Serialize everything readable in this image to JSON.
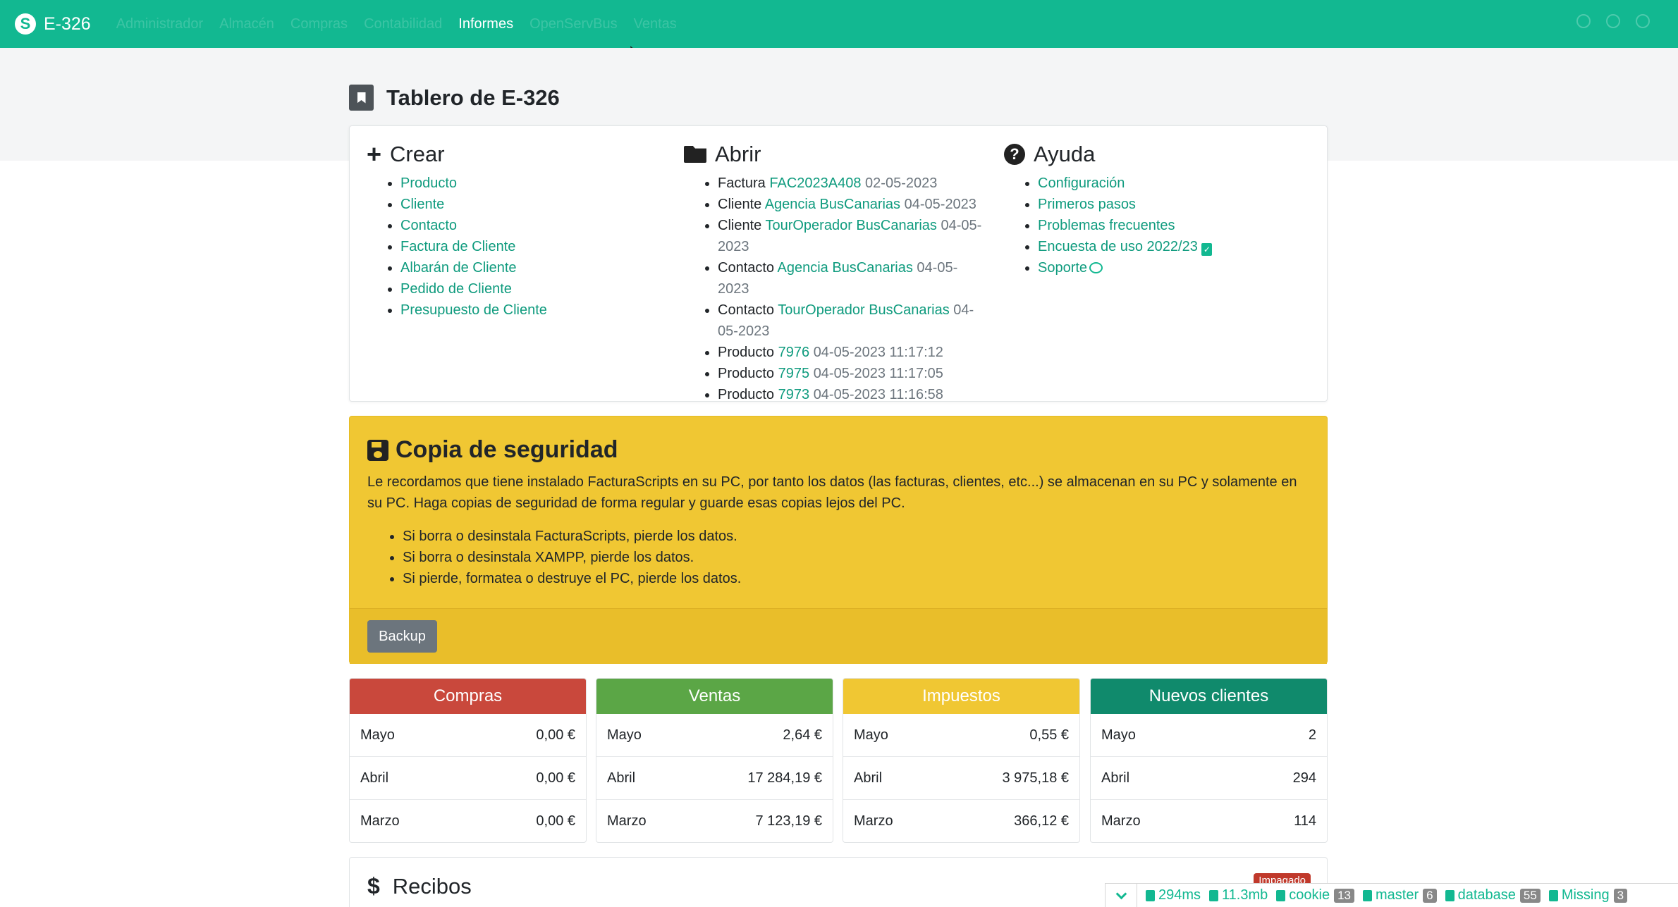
{
  "navbar": {
    "brand_logo": "S",
    "brand_name": "E-326",
    "menu": [
      "Administrador",
      "Almacén",
      "Compras",
      "Contabilidad",
      "Informes",
      "OpenServBus",
      "Ventas"
    ],
    "active": "Informes"
  },
  "page": {
    "title": "Tablero de E-326"
  },
  "crear": {
    "title": "Crear",
    "items": [
      "Producto",
      "Cliente",
      "Contacto",
      "Factura de Cliente",
      "Albarán de Cliente",
      "Pedido de Cliente",
      "Presupuesto de Cliente"
    ]
  },
  "abrir": {
    "title": "Abrir",
    "items": [
      {
        "type": "Factura",
        "link": "FAC2023A408",
        "date": "02-05-2023"
      },
      {
        "type": "Cliente",
        "link": "Agencia BusCanarias",
        "date": "04-05-2023"
      },
      {
        "type": "Cliente",
        "link": "TourOperador BusCanarias",
        "date": "04-05-2023"
      },
      {
        "type": "Contacto",
        "link": "Agencia BusCanarias",
        "date": "04-05-2023"
      },
      {
        "type": "Contacto",
        "link": "TourOperador BusCanarias",
        "date": "04-05-2023"
      },
      {
        "type": "Producto",
        "link": "7976",
        "date": "04-05-2023 11:17:12"
      },
      {
        "type": "Producto",
        "link": "7975",
        "date": "04-05-2023 11:17:05"
      },
      {
        "type": "Producto",
        "link": "7973",
        "date": "04-05-2023 11:16:58"
      }
    ]
  },
  "ayuda": {
    "title": "Ayuda",
    "items": [
      "Configuración",
      "Primeros pasos",
      "Problemas frecuentes",
      "Encuesta de uso 2022/23",
      "Soporte"
    ]
  },
  "backup": {
    "title": "Copia de seguridad",
    "text": "Le recordamos que tiene instalado FacturaScripts en su PC, por tanto los datos (las facturas, clientes, etc...) se almacenan en su PC y solamente en su PC. Haga copias de seguridad de forma regular y guarde esas copias lejos del PC.",
    "bullets": [
      "Si borra o desinstala FacturaScripts, pierde los datos.",
      "Si borra o desinstala XAMPP, pierde los datos.",
      "Si pierde, formatea o destruye el PC, pierde los datos."
    ],
    "button": "Backup"
  },
  "stats": [
    {
      "title": "Compras",
      "color": "#c9483c",
      "rows": [
        [
          "Mayo",
          "0,00 €"
        ],
        [
          "Abril",
          "0,00 €"
        ],
        [
          "Marzo",
          "0,00 €"
        ]
      ]
    },
    {
      "title": "Ventas",
      "color": "#5ba646",
      "rows": [
        [
          "Mayo",
          "2,64 €"
        ],
        [
          "Abril",
          "17 284,19 €"
        ],
        [
          "Marzo",
          "7 123,19 €"
        ]
      ]
    },
    {
      "title": "Impuestos",
      "color": "#f0c733",
      "rows": [
        [
          "Mayo",
          "0,55 €"
        ],
        [
          "Abril",
          "3 975,18 €"
        ],
        [
          "Marzo",
          "366,12 €"
        ]
      ]
    },
    {
      "title": "Nuevos clientes",
      "color": "#108a6c",
      "rows": [
        [
          "Mayo",
          "2"
        ],
        [
          "Abril",
          "294"
        ],
        [
          "Marzo",
          "114"
        ]
      ]
    }
  ],
  "recibos": {
    "title": "Recibos",
    "badge": "Impagado"
  },
  "debugbar": {
    "time": "294ms",
    "memory": "11.3mb",
    "items": [
      {
        "label": "cookie",
        "count": "13"
      },
      {
        "label": "master",
        "count": "6"
      },
      {
        "label": "database",
        "count": "55"
      },
      {
        "label": "Missing",
        "count": "3"
      }
    ]
  }
}
